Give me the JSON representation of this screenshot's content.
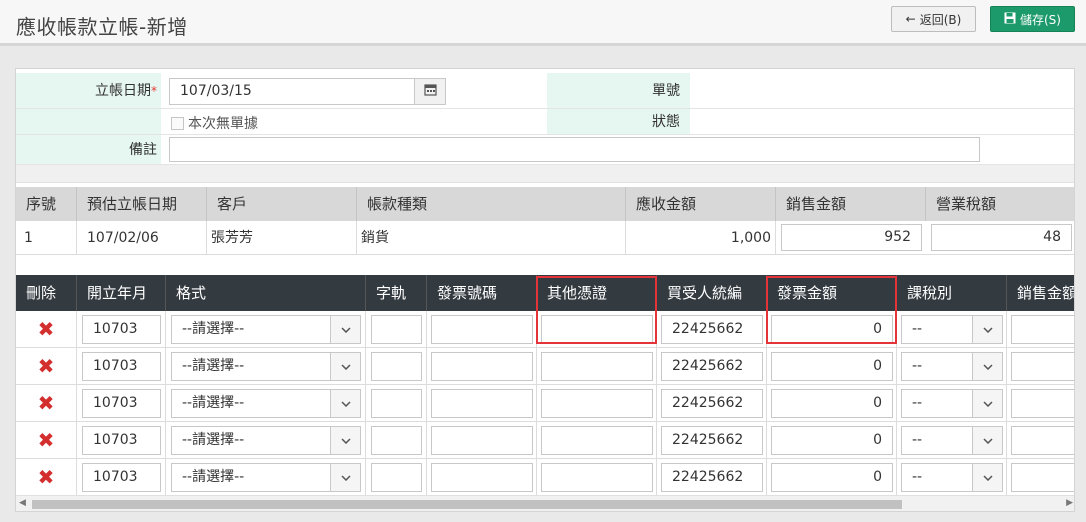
{
  "page": {
    "title": "應收帳款立帳-新增",
    "back_label": "返回(B)",
    "save_label": "儲存(S)",
    "back_icon": "arrow-left-icon",
    "save_icon": "floppy-disk-icon"
  },
  "form": {
    "date_label": "立帳日期",
    "date_required": "*",
    "date_value": "107/03/15",
    "no_receipt_label": "本次無單據",
    "doc_no_label": "單號",
    "doc_no_value": "",
    "status_label": "狀態",
    "status_value": "",
    "note_label": "備註",
    "note_value": ""
  },
  "summary_table": {
    "headers": [
      "序號",
      "預估立帳日期",
      "客戶",
      "帳款種類",
      "應收金額",
      "銷售金額",
      "營業稅額"
    ],
    "row": {
      "seq": "1",
      "est_date": "107/02/06",
      "customer": "張芳芳",
      "type": "銷貨",
      "receivable": "1,000",
      "sales": "952",
      "tax": "48"
    }
  },
  "invoice_table": {
    "headers": [
      "刪除",
      "開立年月",
      "格式",
      "字軌",
      "發票號碼",
      "其他憑證",
      "買受人統編",
      "發票金額",
      "課稅別",
      "銷售金額"
    ],
    "rows": [
      {
        "year_month": "10703",
        "format": "--請選擇--",
        "track": "",
        "invoice_no": "",
        "other_doc": "",
        "buyer_id": "22425662",
        "amount": "0",
        "tax_type": "--",
        "sales": ""
      },
      {
        "year_month": "10703",
        "format": "--請選擇--",
        "track": "",
        "invoice_no": "",
        "other_doc": "",
        "buyer_id": "22425662",
        "amount": "0",
        "tax_type": "--",
        "sales": ""
      },
      {
        "year_month": "10703",
        "format": "--請選擇--",
        "track": "",
        "invoice_no": "",
        "other_doc": "",
        "buyer_id": "22425662",
        "amount": "0",
        "tax_type": "--",
        "sales": ""
      },
      {
        "year_month": "10703",
        "format": "--請選擇--",
        "track": "",
        "invoice_no": "",
        "other_doc": "",
        "buyer_id": "22425662",
        "amount": "0",
        "tax_type": "--",
        "sales": ""
      },
      {
        "year_month": "10703",
        "format": "--請選擇--",
        "track": "",
        "invoice_no": "",
        "other_doc": "",
        "buyer_id": "22425662",
        "amount": "0",
        "tax_type": "--",
        "sales": ""
      }
    ]
  },
  "colors": {
    "accent": "#1d9a6c",
    "label_bg": "#e6f6f1",
    "header_dark": "#333a40",
    "highlight": "#e5333a",
    "delete": "#d32f2f"
  }
}
